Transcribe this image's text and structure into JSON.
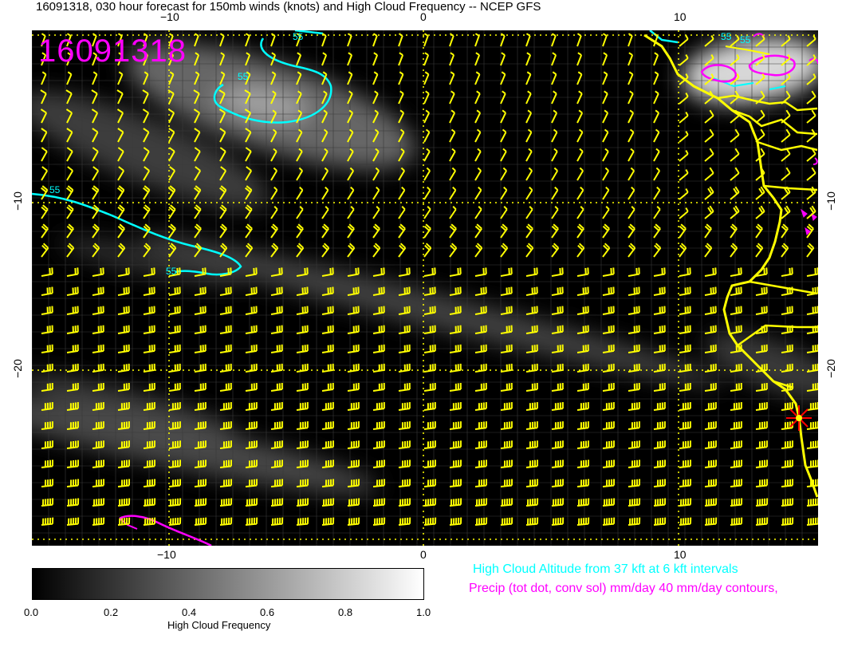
{
  "title": "16091318, 030 hour forecast for 150mb winds (knots) and High Cloud Frequency -- NCEP GFS",
  "stamp": "16091318",
  "axis": {
    "top_ticks": [
      "−10",
      "0",
      "10"
    ],
    "bottom_ticks": [
      "−10",
      "0",
      "10"
    ],
    "left_ticks": [
      "−10",
      "−20"
    ],
    "right_ticks": [
      "−10",
      "−20"
    ]
  },
  "contour_labels": {
    "cyan": [
      "55",
      "55",
      "55",
      "55",
      "55",
      "55"
    ]
  },
  "colorbar": {
    "ticks": [
      "0.0",
      "0.2",
      "0.4",
      "0.6",
      "0.8",
      "1.0"
    ],
    "title": "High Cloud Frequency"
  },
  "notes": {
    "cloud_altitude": "High Cloud Altitude from 37 kft at 6 kft intervals",
    "precip": "Precip (tot dot, conv sol) mm/day 40 mm/day contours,"
  },
  "colors": {
    "wind_barbs": "#ffff00",
    "coastline": "#ffff00",
    "cloud_contour": "#00ffff",
    "precip_contour": "#ff00ff",
    "marker": "#ff0000",
    "background": "#000000"
  },
  "icons": [
    "wind-barb-icon",
    "star-marker-icon"
  ]
}
